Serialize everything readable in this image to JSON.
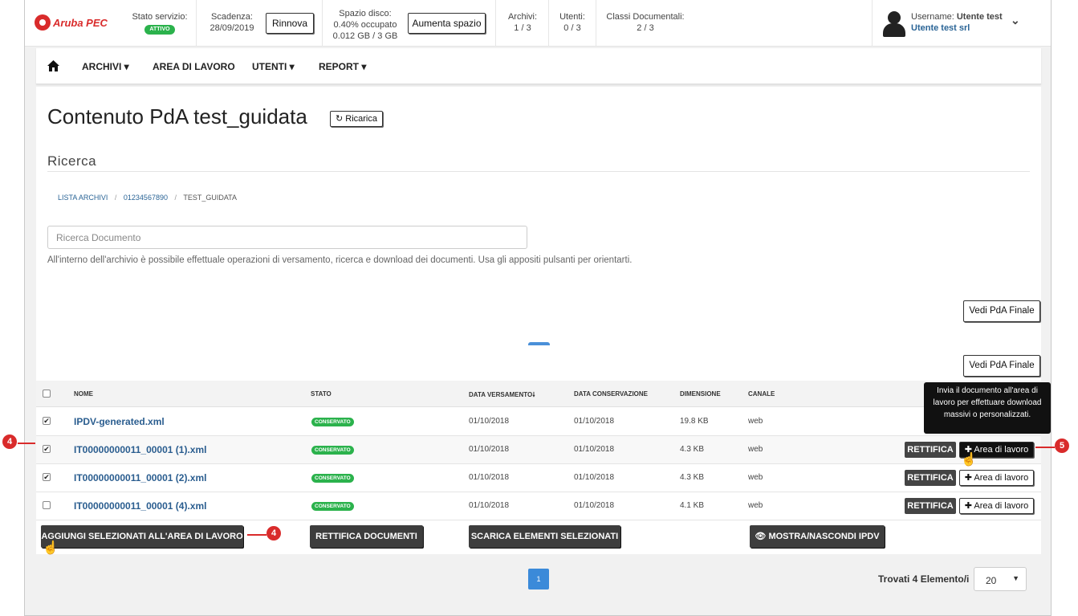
{
  "brand": {
    "logo_text": "Aruba PEC"
  },
  "topbar": {
    "stato_label": "Stato servizio:",
    "stato_value": "ATTIVO",
    "scadenza_label": "Scadenza:",
    "scadenza_value": "28/09/2019",
    "rinnova_label": "Rinnova",
    "spazio_label": "Spazio disco:",
    "spazio_percent": "0.40% occupato",
    "spazio_value": "0.012 GB / 3 GB",
    "aumenta_label": "Aumenta spazio",
    "archivi_label": "Archivi:",
    "archivi_value": "1 / 3",
    "utenti_label": "Utenti:",
    "utenti_value": "0 / 3",
    "classi_label": "Classi Documentali:",
    "classi_value": "2 / 3",
    "username_label": "Username:",
    "username_value": "Utente test",
    "company": "Utente test srl"
  },
  "nav": {
    "home_icon": "home-icon",
    "items": [
      "ARCHIVI ▾",
      "AREA DI LAVORO",
      "UTENTI ▾",
      "REPORT ▾"
    ]
  },
  "page": {
    "title": "Contenuto PdA test_guidata",
    "ricarica_label": "Ricarica",
    "section_title": "Ricerca",
    "breadcrumb": [
      "LISTA ARCHIVI",
      "01234567890",
      "TEST_GUIDATA"
    ],
    "search_placeholder": "Ricerca Documento",
    "helper_text": "All'interno dell'archivio è possibile effettuale operazioni di versamento, ricerca e download dei documenti. Usa gli appositi pulsanti per orientarti.",
    "vedi_label": "Vedi PdA Finale"
  },
  "table": {
    "headers": [
      "NOME",
      "STATO",
      "DATA VERSAMENTO",
      "DATA CONSERVAZIONE",
      "DIMENSIONE",
      "CANALE"
    ],
    "sort_indicator": "🠗",
    "rows": [
      {
        "name": "IPDV-generated.xml",
        "stato": "CONSERVATO",
        "data_versamento": "01/10/2018",
        "data_conservazione": "01/10/2018",
        "dimensione": "19.8 KB",
        "canale": "web",
        "checked": "✔"
      },
      {
        "name": "IT00000000011_00001 (1).xml",
        "stato": "CONSERVATO",
        "data_versamento": "01/10/2018",
        "data_conservazione": "01/10/2018",
        "dimensione": "4.3 KB",
        "canale": "web",
        "checked": "✔"
      },
      {
        "name": "IT00000000011_00001 (2).xml",
        "stato": "CONSERVATO",
        "data_versamento": "01/10/2018",
        "data_conservazione": "01/10/2018",
        "dimensione": "4.3 KB",
        "canale": "web",
        "checked": "✔"
      },
      {
        "name": "IT00000000011_00001 (4).xml",
        "stato": "CONSERVATO",
        "data_versamento": "01/10/2018",
        "data_conservazione": "01/10/2018",
        "dimensione": "4.1 KB",
        "canale": "web",
        "checked": ""
      }
    ],
    "rettifica_label": "RETTIFICA",
    "area_label": "✚ Area di lavoro",
    "tooltip": "Invia il documento all'area di lavoro per effettuare download massivi o personalizzati."
  },
  "actions": {
    "aggiungi": "AGGIUNGI SELEZIONATI ALL'AREA DI LAVORO",
    "rettifica_documenti": "RETTIFICA DOCUMENTI",
    "scarica": "SCARICA ELEMENTI SELEZIONATI",
    "mostra": "MOSTRA/NASCONDI IPDV"
  },
  "footer": {
    "page_number": "1",
    "found_text": "Trovati 4 Elemento/i",
    "page_size": "20"
  },
  "callouts": {
    "a": "4",
    "b": "4",
    "c": "5"
  },
  "colors": {
    "brand_red": "#d92b2b",
    "status_green": "#2bb24c",
    "pager_blue": "#3b8ad9",
    "link_blue": "#2a5d8f"
  }
}
